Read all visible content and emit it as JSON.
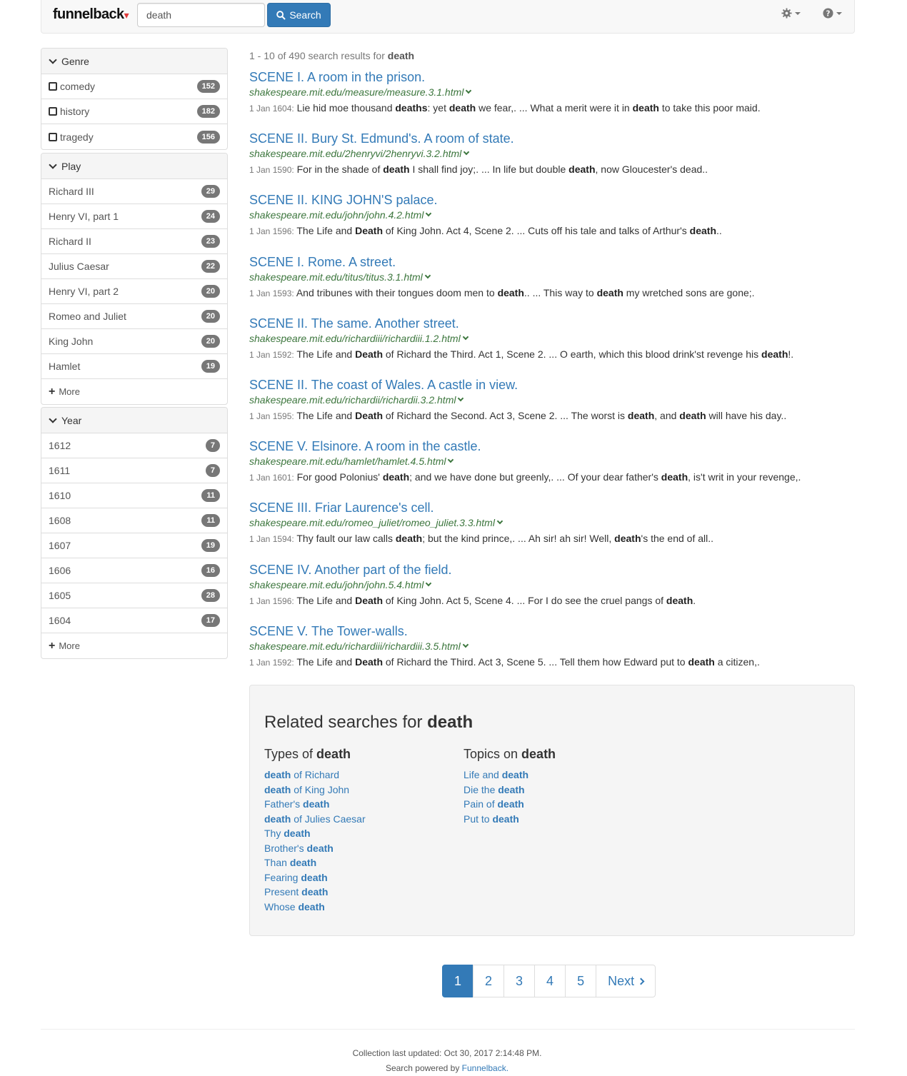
{
  "navbar": {
    "brand": "funnelback",
    "search_value": "death",
    "search_label": "Search"
  },
  "facets": [
    {
      "title": "Genre",
      "checkbox": true,
      "items": [
        {
          "label": "comedy",
          "count": "152"
        },
        {
          "label": "history",
          "count": "182"
        },
        {
          "label": "tragedy",
          "count": "156"
        }
      ]
    },
    {
      "title": "Play",
      "checkbox": false,
      "items": [
        {
          "label": "Richard III",
          "count": "29"
        },
        {
          "label": "Henry VI, part 1",
          "count": "24"
        },
        {
          "label": "Richard II",
          "count": "23"
        },
        {
          "label": "Julius Caesar",
          "count": "22"
        },
        {
          "label": "Henry VI, part 2",
          "count": "20"
        },
        {
          "label": "Romeo and Juliet",
          "count": "20"
        },
        {
          "label": "King John",
          "count": "20"
        },
        {
          "label": "Hamlet",
          "count": "19"
        }
      ],
      "more": "More"
    },
    {
      "title": "Year",
      "checkbox": false,
      "items": [
        {
          "label": "1612",
          "count": "7"
        },
        {
          "label": "1611",
          "count": "7"
        },
        {
          "label": "1610",
          "count": "11"
        },
        {
          "label": "1608",
          "count": "11"
        },
        {
          "label": "1607",
          "count": "19"
        },
        {
          "label": "1606",
          "count": "16"
        },
        {
          "label": "1605",
          "count": "28"
        },
        {
          "label": "1604",
          "count": "17"
        }
      ],
      "more": "More"
    }
  ],
  "summary": {
    "prefix": "1 - 10 of 490 search results for ",
    "query": "death"
  },
  "results": [
    {
      "title": "SCENE I. A room in the prison.",
      "url": "shakespeare.mit.edu/measure/measure.3.1.html",
      "date": "1 Jan 1604:",
      "snippet": [
        " Lie hid moe thousand ",
        "*deaths",
        ": yet ",
        "*death",
        " we fear,. ... What a merit were it in ",
        "*death",
        " to take this poor maid."
      ]
    },
    {
      "title": "SCENE II. Bury St. Edmund's. A room of state.",
      "url": "shakespeare.mit.edu/2henryvi/2henryvi.3.2.html",
      "date": "1 Jan 1590:",
      "snippet": [
        " For in the shade of ",
        "*death",
        " I shall find joy;. ... In life but double ",
        "*death",
        ", now Gloucester's dead.."
      ]
    },
    {
      "title": "SCENE II. KING JOHN'S palace.",
      "url": "shakespeare.mit.edu/john/john.4.2.html",
      "date": "1 Jan 1596:",
      "snippet": [
        " The Life and ",
        "*Death",
        " of King John. Act 4, Scene 2. ... Cuts off his tale and talks of Arthur's ",
        "*death",
        ".."
      ]
    },
    {
      "title": "SCENE I. Rome. A street.",
      "url": "shakespeare.mit.edu/titus/titus.3.1.html",
      "date": "1 Jan 1593:",
      "snippet": [
        " And tribunes with their tongues doom men to ",
        "*death",
        ".. ... This way to ",
        "*death",
        " my wretched sons are gone;."
      ]
    },
    {
      "title": "SCENE II. The same. Another street.",
      "url": "shakespeare.mit.edu/richardiii/richardiii.1.2.html",
      "date": "1 Jan 1592:",
      "snippet": [
        " The Life and ",
        "*Death",
        " of Richard the Third. Act 1, Scene 2. ... O earth, which this blood drink'st revenge his ",
        "*death",
        "!."
      ]
    },
    {
      "title": "SCENE II. The coast of Wales. A castle in view.",
      "url": "shakespeare.mit.edu/richardii/richardii.3.2.html",
      "date": "1 Jan 1595:",
      "snippet": [
        " The Life and ",
        "*Death",
        " of Richard the Second. Act 3, Scene 2. ... The worst is ",
        "*death",
        ", and ",
        "*death",
        " will have his day.."
      ]
    },
    {
      "title": "SCENE V. Elsinore. A room in the castle.",
      "url": "shakespeare.mit.edu/hamlet/hamlet.4.5.html",
      "date": "1 Jan 1601:",
      "snippet": [
        " For good Polonius' ",
        "*death",
        "; and we have done but greenly,. ... Of your dear father's ",
        "*death",
        ", is't writ in your revenge,."
      ]
    },
    {
      "title": "SCENE III. Friar Laurence's cell.",
      "url": "shakespeare.mit.edu/romeo_juliet/romeo_juliet.3.3.html",
      "date": "1 Jan 1594:",
      "snippet": [
        " Thy fault our law calls ",
        "*death",
        "; but the kind prince,. ... Ah sir! ah sir! Well, ",
        "*death",
        "'s the end of all.."
      ]
    },
    {
      "title": "SCENE IV. Another part of the field.",
      "url": "shakespeare.mit.edu/john/john.5.4.html",
      "date": "1 Jan 1596:",
      "snippet": [
        " The Life and ",
        "*Death",
        " of King John. Act 5, Scene 4. ... For I do see the cruel pangs of ",
        "*death",
        "."
      ]
    },
    {
      "title": "SCENE V. The Tower-walls.",
      "url": "shakespeare.mit.edu/richardiii/richardiii.3.5.html",
      "date": "1 Jan 1592:",
      "snippet": [
        " The Life and ",
        "*Death",
        " of Richard the Third. Act 3, Scene 5. ... Tell them how Edward put to ",
        "*death",
        " a citizen,."
      ]
    }
  ],
  "related": {
    "heading_prefix": "Related searches for ",
    "heading_query": "death",
    "types_prefix": "Types of ",
    "topics_prefix": "Topics on ",
    "types": [
      [
        "*death",
        " of Richard"
      ],
      [
        "*death",
        " of King John"
      ],
      [
        "Father's ",
        "*death"
      ],
      [
        "*death",
        " of Julies Caesar"
      ],
      [
        "Thy ",
        "*death"
      ],
      [
        "Brother's ",
        "*death"
      ],
      [
        "Than ",
        "*death"
      ],
      [
        "Fearing ",
        "*death"
      ],
      [
        "Present ",
        "*death"
      ],
      [
        "Whose ",
        "*death"
      ]
    ],
    "topics": [
      [
        "Life and ",
        "*death"
      ],
      [
        "Die the ",
        "*death"
      ],
      [
        "Pain of ",
        "*death"
      ],
      [
        "Put to ",
        "*death"
      ]
    ]
  },
  "pagination": {
    "pages": [
      "1",
      "2",
      "3",
      "4",
      "5"
    ],
    "active": "1",
    "next": "Next"
  },
  "footer": {
    "updated": "Collection last updated: Oct 30, 2017 2:14:48 PM.",
    "powered_prefix": "Search powered by ",
    "powered_link": "Funnelback."
  },
  "colors": {
    "link": "#337ab7",
    "url_green": "#3c763d",
    "badge": "#777777"
  }
}
